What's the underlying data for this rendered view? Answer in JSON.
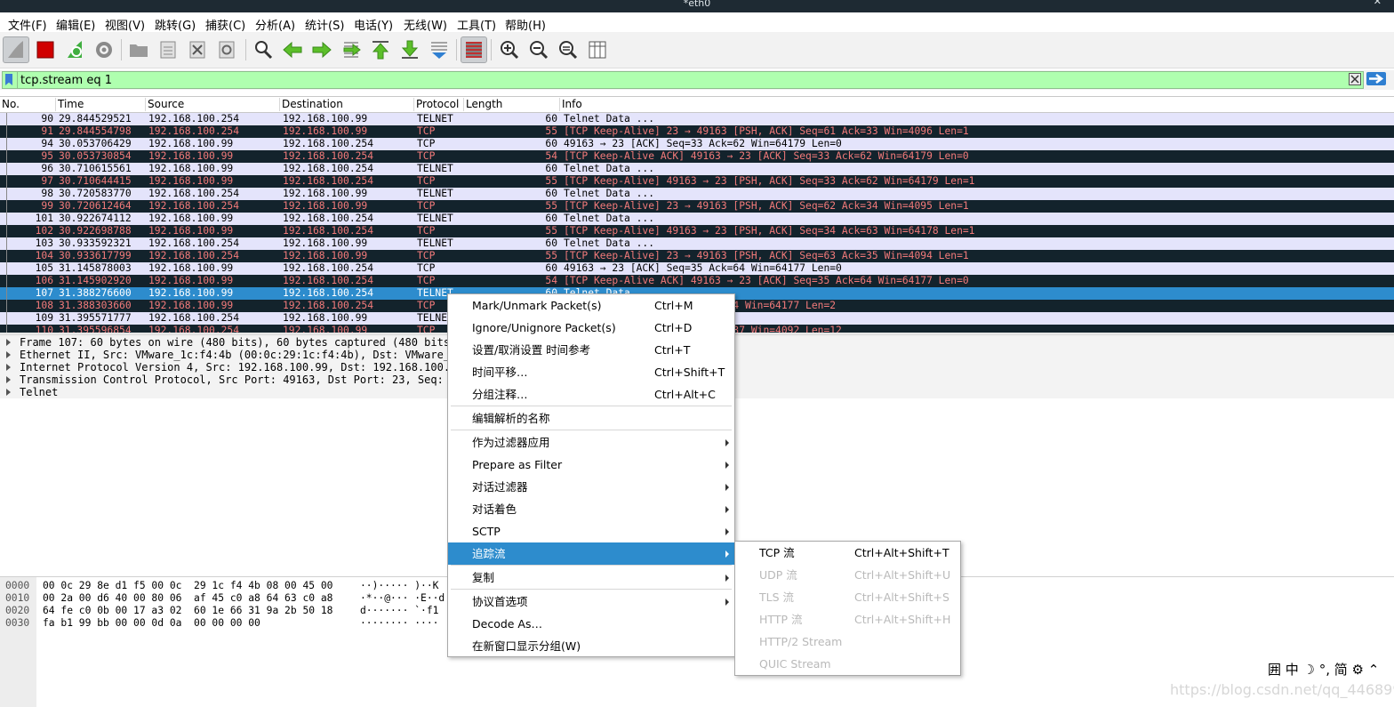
{
  "window": {
    "title": "*eth0",
    "close": "✕"
  },
  "menubar": [
    "文件(F)",
    "编辑(E)",
    "视图(V)",
    "跳转(G)",
    "捕获(C)",
    "分析(A)",
    "统计(S)",
    "电话(Y)",
    "无线(W)",
    "工具(T)",
    "帮助(H)"
  ],
  "toolbar": {
    "icons": [
      "shark-fin-start-icon",
      "stop-capture-icon",
      "restart-capture-icon",
      "capture-options-icon",
      "open-file-icon",
      "save-file-icon",
      "close-file-icon",
      "reload-file-icon",
      "find-packet-icon",
      "go-back-icon",
      "go-forward-icon",
      "go-to-packet-icon",
      "go-first-icon",
      "go-last-icon",
      "autoscroll-icon",
      "colorize-icon",
      "zoom-in-icon",
      "zoom-out-icon",
      "zoom-normal-icon",
      "resize-columns-icon"
    ]
  },
  "filter": {
    "value": "tcp.stream eq 1"
  },
  "columns": [
    "No.",
    "Time",
    "Source",
    "Destination",
    "Protocol",
    "Length",
    "Info"
  ],
  "colors": {
    "normal_bg": "#e4e4fb",
    "dark_bg": "#13232c",
    "dark_fg": "#f27a7a",
    "selected_bg": "#2d8ccd",
    "filter_bg": "#afffaf"
  },
  "packets": [
    {
      "no": "90",
      "time": "29.844529521",
      "src": "192.168.100.254",
      "dst": "192.168.100.99",
      "proto": "TELNET",
      "len": "60",
      "info": "Telnet Data ...",
      "style": "normal"
    },
    {
      "no": "91",
      "time": "29.844554798",
      "src": "192.168.100.254",
      "dst": "192.168.100.99",
      "proto": "TCP",
      "len": "55",
      "info": "[TCP Keep-Alive] 23 → 49163 [PSH, ACK] Seq=61 Ack=33 Win=4096 Len=1",
      "style": "dark"
    },
    {
      "no": "94",
      "time": "30.053706429",
      "src": "192.168.100.99",
      "dst": "192.168.100.254",
      "proto": "TCP",
      "len": "60",
      "info": "49163 → 23 [ACK] Seq=33 Ack=62 Win=64179 Len=0",
      "style": "normal"
    },
    {
      "no": "95",
      "time": "30.053730854",
      "src": "192.168.100.99",
      "dst": "192.168.100.254",
      "proto": "TCP",
      "len": "54",
      "info": "[TCP Keep-Alive ACK] 49163 → 23 [ACK] Seq=33 Ack=62 Win=64179 Len=0",
      "style": "dark"
    },
    {
      "no": "96",
      "time": "30.710615561",
      "src": "192.168.100.99",
      "dst": "192.168.100.254",
      "proto": "TELNET",
      "len": "60",
      "info": "Telnet Data ...",
      "style": "normal"
    },
    {
      "no": "97",
      "time": "30.710644415",
      "src": "192.168.100.99",
      "dst": "192.168.100.254",
      "proto": "TCP",
      "len": "55",
      "info": "[TCP Keep-Alive] 49163 → 23 [PSH, ACK] Seq=33 Ack=62 Win=64179 Len=1",
      "style": "dark"
    },
    {
      "no": "98",
      "time": "30.720583770",
      "src": "192.168.100.254",
      "dst": "192.168.100.99",
      "proto": "TELNET",
      "len": "60",
      "info": "Telnet Data ...",
      "style": "normal"
    },
    {
      "no": "99",
      "time": "30.720612464",
      "src": "192.168.100.254",
      "dst": "192.168.100.99",
      "proto": "TCP",
      "len": "55",
      "info": "[TCP Keep-Alive] 23 → 49163 [PSH, ACK] Seq=62 Ack=34 Win=4095 Len=1",
      "style": "dark"
    },
    {
      "no": "101",
      "time": "30.922674112",
      "src": "192.168.100.99",
      "dst": "192.168.100.254",
      "proto": "TELNET",
      "len": "60",
      "info": "Telnet Data ...",
      "style": "normal"
    },
    {
      "no": "102",
      "time": "30.922698788",
      "src": "192.168.100.99",
      "dst": "192.168.100.254",
      "proto": "TCP",
      "len": "55",
      "info": "[TCP Keep-Alive] 49163 → 23 [PSH, ACK] Seq=34 Ack=63 Win=64178 Len=1",
      "style": "dark"
    },
    {
      "no": "103",
      "time": "30.933592321",
      "src": "192.168.100.254",
      "dst": "192.168.100.99",
      "proto": "TELNET",
      "len": "60",
      "info": "Telnet Data ...",
      "style": "normal"
    },
    {
      "no": "104",
      "time": "30.933617799",
      "src": "192.168.100.254",
      "dst": "192.168.100.99",
      "proto": "TCP",
      "len": "55",
      "info": "[TCP Keep-Alive] 23 → 49163 [PSH, ACK] Seq=63 Ack=35 Win=4094 Len=1",
      "style": "dark"
    },
    {
      "no": "105",
      "time": "31.145878003",
      "src": "192.168.100.99",
      "dst": "192.168.100.254",
      "proto": "TCP",
      "len": "60",
      "info": "49163 → 23 [ACK] Seq=35 Ack=64 Win=64177 Len=0",
      "style": "normal"
    },
    {
      "no": "106",
      "time": "31.145902920",
      "src": "192.168.100.99",
      "dst": "192.168.100.254",
      "proto": "TCP",
      "len": "54",
      "info": "[TCP Keep-Alive ACK] 49163 → 23 [ACK] Seq=35 Ack=64 Win=64177 Len=0",
      "style": "dark"
    },
    {
      "no": "107",
      "time": "31.388276600",
      "src": "192.168.100.99",
      "dst": "192.168.100.254",
      "proto": "TELNET",
      "len": "60",
      "info": "Telnet Data ...",
      "style": "selected"
    },
    {
      "no": "108",
      "time": "31.388303660",
      "src": "192.168.100.99",
      "dst": "192.168.100.254",
      "proto": "TCP",
      "len": "",
      "info": "→ 23 [PSH, ACK] Seq=35 Ack=64 Win=64177 Len=2",
      "style": "dark"
    },
    {
      "no": "109",
      "time": "31.395571777",
      "src": "192.168.100.254",
      "dst": "192.168.100.99",
      "proto": "TELNE",
      "len": "",
      "info": "",
      "style": "normal"
    },
    {
      "no": "110",
      "time": "31.395596854",
      "src": "192.168.100.254",
      "dst": "192.168.100.99",
      "proto": "TCP",
      "len": "",
      "info": "49163 [PSH, ACK] Seq=64 Ack=37 Win=4092 Len=12",
      "style": "dark"
    }
  ],
  "details": [
    "Frame 107: 60 bytes on wire (480 bits), 60 bytes captured (480 bits",
    "Ethernet II, Src: VMware_1c:f4:4b (00:0c:29:1c:f4:4b), Dst: VMware_",
    "Internet Protocol Version 4, Src: 192.168.100.99, Dst: 192.168.100.",
    "Transmission Control Protocol, Src Port: 49163, Dst Port: 23, Seq:",
    "Telnet"
  ],
  "bytes": {
    "offsets": [
      "0000",
      "0010",
      "0020",
      "0030"
    ],
    "hex": [
      "00 0c 29 8e d1 f5 00 0c  29 1c f4 4b 08 00 45 00",
      "00 2a 00 d6 40 00 80 06  af 45 c0 a8 64 63 c0 a8",
      "64 fe c0 0b 00 17 a3 02  60 1e 66 31 9a 2b 50 18",
      "fa b1 99 bb 00 00 0d 0a  00 00 00 00"
    ],
    "ascii": [
      "··)····· )··K",
      "·*··@··· ·E··d",
      "d······· `·f1",
      "········ ····"
    ]
  },
  "context_menu": [
    {
      "label": "Mark/Unmark Packet(s)",
      "shortcut": "Ctrl+M"
    },
    {
      "label": "Ignore/Unignore Packet(s)",
      "shortcut": "Ctrl+D"
    },
    {
      "label": "设置/取消设置 时间参考",
      "shortcut": "Ctrl+T"
    },
    {
      "label": "时间平移…",
      "shortcut": "Ctrl+Shift+T"
    },
    {
      "label": "分组注释…",
      "shortcut": "Ctrl+Alt+C"
    },
    {
      "label": "编辑解析的名称",
      "shortcut": ""
    },
    {
      "label": "作为过滤器应用",
      "shortcut": ""
    },
    {
      "label": "Prepare as Filter",
      "shortcut": ""
    },
    {
      "label": "对话过滤器",
      "shortcut": ""
    },
    {
      "label": "对话着色",
      "shortcut": ""
    },
    {
      "label": "SCTP",
      "shortcut": ""
    },
    {
      "label": "追踪流",
      "shortcut": ""
    },
    {
      "label": "复制",
      "shortcut": ""
    },
    {
      "label": "协议首选项",
      "shortcut": ""
    },
    {
      "label": "Decode As…",
      "shortcut": ""
    },
    {
      "label": "在新窗口显示分组(W)",
      "shortcut": ""
    }
  ],
  "follow_submenu": [
    {
      "label": "TCP 流",
      "shortcut": "Ctrl+Alt+Shift+T",
      "enabled": true
    },
    {
      "label": "UDP 流",
      "shortcut": "Ctrl+Alt+Shift+U",
      "enabled": false
    },
    {
      "label": "TLS 流",
      "shortcut": "Ctrl+Alt+Shift+S",
      "enabled": false
    },
    {
      "label": "HTTP 流",
      "shortcut": "Ctrl+Alt+Shift+H",
      "enabled": false
    },
    {
      "label": "HTTP/2 Stream",
      "shortcut": "",
      "enabled": false
    },
    {
      "label": "QUIC Stream",
      "shortcut": "",
      "enabled": false
    }
  ],
  "ime": {
    "text": "囲 中 ☽ °, 简 ⚙ ⌃"
  },
  "watermark": "https://blog.csdn.net/qq_44689930"
}
